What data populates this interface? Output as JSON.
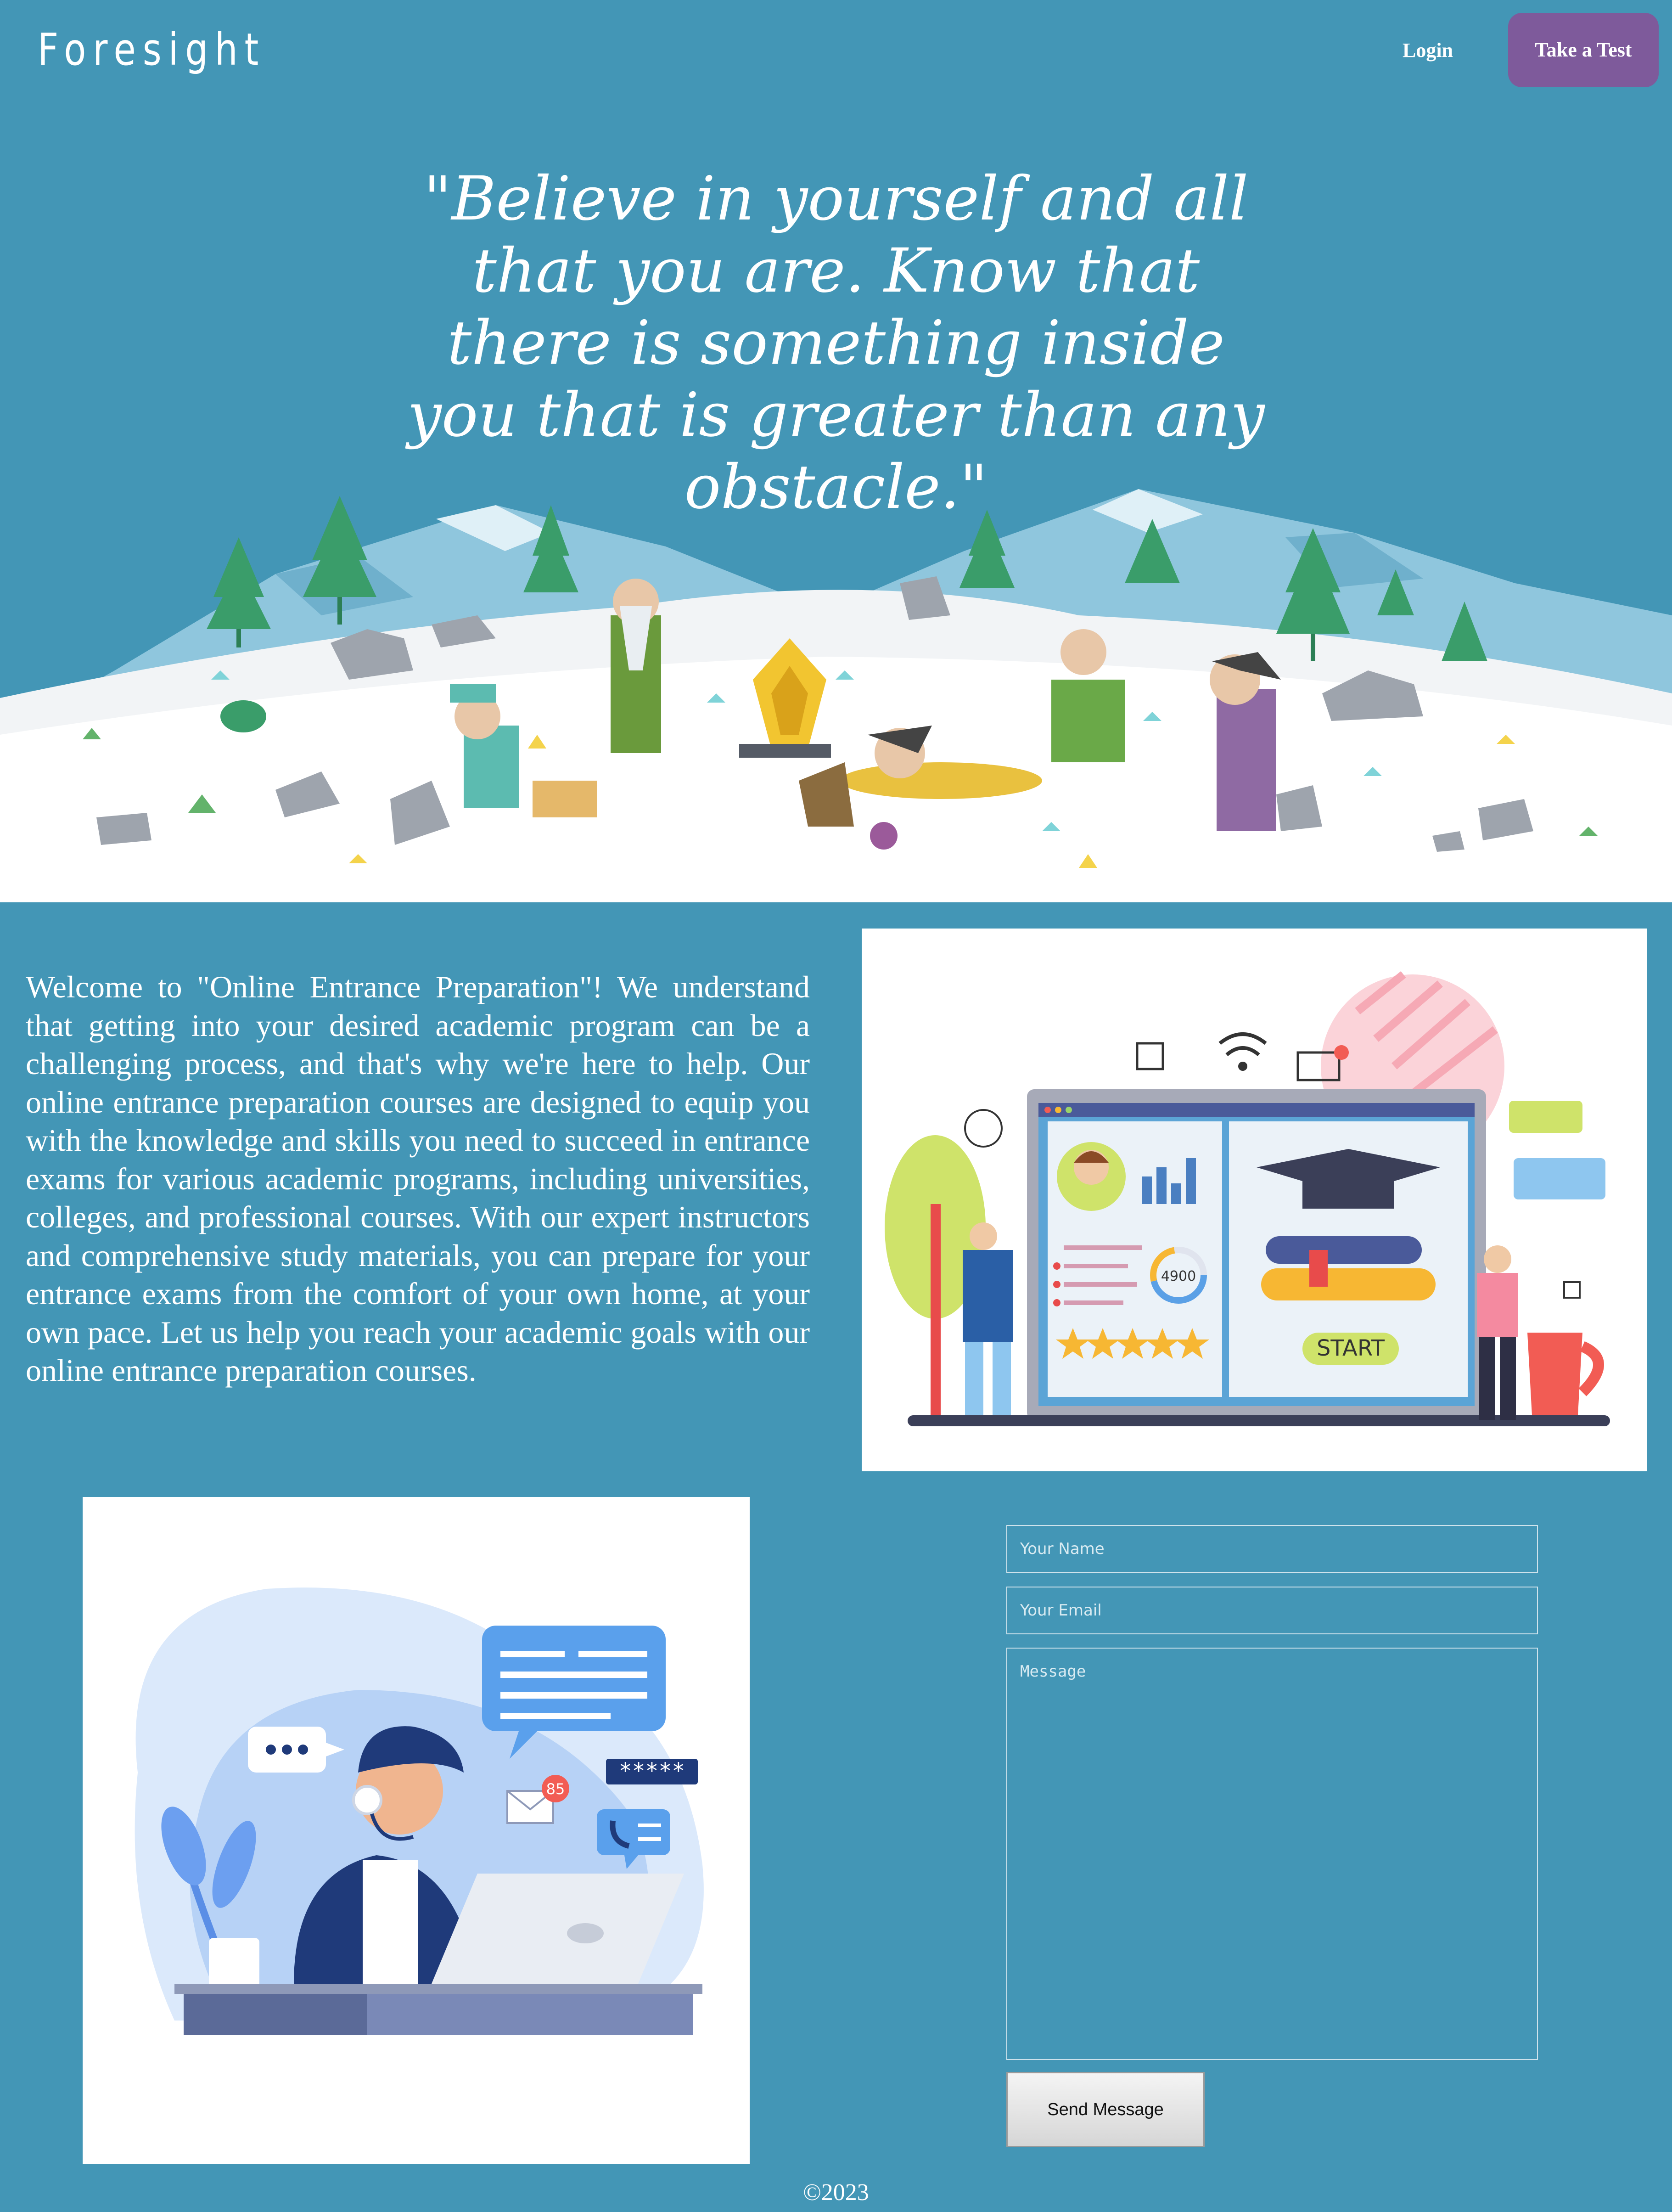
{
  "nav": {
    "brand": "Foresight",
    "login_label": "Login",
    "cta_label": "Take a Test"
  },
  "hero": {
    "quote": "\"Believe in yourself and all that you are. Know that there is something inside you that is greater than any obstacle.\"",
    "illustration": "cartoon-campers-in-snowy-mountains"
  },
  "intro": {
    "text": "Welcome to \"Online Entrance Preparation\"! We understand that getting into your desired academic program can be a challenging process, and that's why we're here to help. Our online entrance preparation courses are designed to equip you with the knowledge and skills you need to succeed in entrance exams for various academic programs, including universities, colleges, and professional courses. With our expert instructors and comprehensive study materials, you can prepare for your entrance exams from the comfort of your own home, at your own pace. Let us help you reach your academic goals with our online entrance preparation courses.",
    "illustration": "online-course-dashboard",
    "score_badge": "4900",
    "start_label": "START"
  },
  "contact": {
    "illustration": "support-agent-with-headset",
    "notification_count": "85",
    "password_mask": "*****",
    "name_placeholder": "Your Name",
    "email_placeholder": "Your Email",
    "message_placeholder": "Message",
    "send_label": "Send Message"
  },
  "footer": {
    "copyright": "©2023"
  },
  "colors": {
    "background": "#4396b6",
    "cta": "#7e5a9b",
    "white": "#ffffff"
  }
}
